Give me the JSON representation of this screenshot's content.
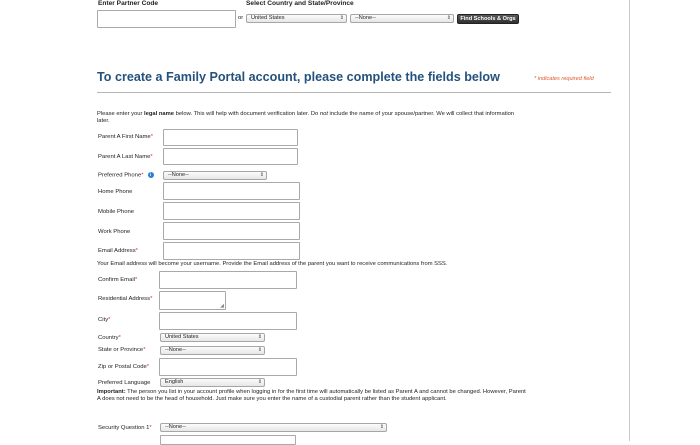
{
  "partner": {
    "code_label": "Enter Partner Code",
    "country_state_label": "Select Country and State/Province",
    "or_text": "or",
    "country_value": "United States",
    "state_value": "--None--",
    "find_button": "Find Schools & Orgs"
  },
  "form": {
    "title": "To create a Family Portal account, please complete the fields below",
    "required_note": "* indicates required field",
    "intro_pre": "Please enter your ",
    "intro_bold": "legal name",
    "intro_mid": " below. This will help with document verification later. Do ",
    "intro_not": "not",
    "intro_post": " include the name of your spouse/partner. We will collect that information later.",
    "fields": {
      "first_name": "Parent A First Name",
      "last_name": "Parent A Last Name",
      "preferred_phone": "Preferred Phone",
      "preferred_phone_value": "--None--",
      "home_phone": "Home Phone",
      "mobile_phone": "Mobile Phone",
      "work_phone": "Work Phone",
      "email": "Email Address",
      "email_note": "Your Email address will become your username. Provide the Email address of the parent you want to receive communications from SSS.",
      "confirm_email": "Confirm Email",
      "residential_address": "Residential Address",
      "city": "City",
      "country": "Country",
      "country_value": "United States",
      "state": "State or Province",
      "state_value": "--None--",
      "zip": "Zip or Postal Code",
      "language": "Preferred Language",
      "language_value": "English",
      "important_label": "Important:",
      "important_text": " The person you list in your account profile when logging in for the first time will automatically be listed as Parent A and cannot be changed. However, Parent A does not need to be the head of household. Just make sure you enter the name of a custodial parent rather than the student applicant.",
      "security_q1": "Security Question 1",
      "security_q1_value": "--None--"
    }
  },
  "colors": {
    "title": "#24527d",
    "required": "#d9372b",
    "required_note": "#e3572c",
    "info_icon": "#2a7fd3"
  }
}
